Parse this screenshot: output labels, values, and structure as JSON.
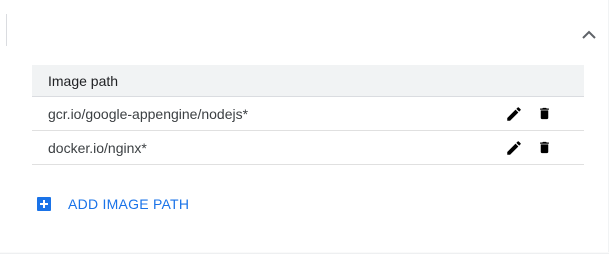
{
  "table": {
    "header": "Image path",
    "rows": [
      {
        "path": "gcr.io/google-appengine/nodejs*"
      },
      {
        "path": "docker.io/nginx*"
      }
    ]
  },
  "actions": {
    "add_label": "ADD IMAGE PATH"
  },
  "icons": {
    "collapse": "chevron-up-icon",
    "edit": "pencil-icon",
    "delete": "trash-icon",
    "add": "plus-box-icon"
  },
  "colors": {
    "accent": "#1a73e8",
    "header_bg": "#f1f3f4",
    "text": "#202124",
    "icon": "#000000"
  }
}
